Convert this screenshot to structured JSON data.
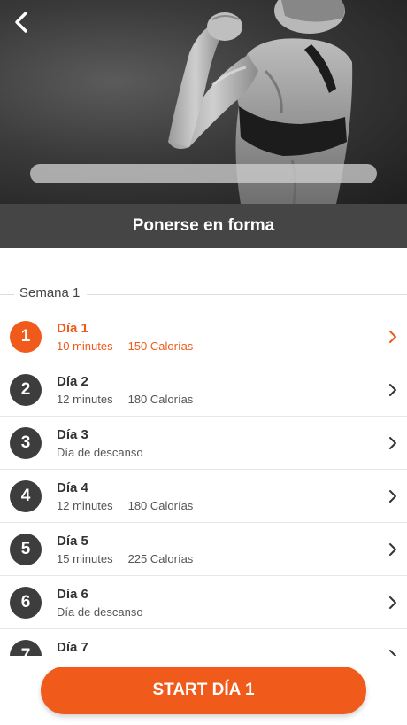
{
  "header": {
    "back_icon": "chevron-left-icon",
    "photo_subject": "athlete-flexing-arm-photo",
    "progress_fraction": 0.0
  },
  "plan": {
    "title": "Ponerse en forma"
  },
  "week": {
    "label": "Semana 1"
  },
  "days": [
    {
      "number": "1",
      "title": "Día 1",
      "minutes": "10 minutes",
      "calories": "150 Calorías",
      "active": true
    },
    {
      "number": "2",
      "title": "Día 2",
      "minutes": "12 minutes",
      "calories": "180 Calorías",
      "active": false
    },
    {
      "number": "3",
      "title": "Día 3",
      "rest": "Día de descanso",
      "active": false
    },
    {
      "number": "4",
      "title": "Día 4",
      "minutes": "12 minutes",
      "calories": "180 Calorías",
      "active": false
    },
    {
      "number": "5",
      "title": "Día 5",
      "minutes": "15 minutes",
      "calories": "225 Calorías",
      "active": false
    },
    {
      "number": "6",
      "title": "Día 6",
      "rest": "Día de descanso",
      "active": false
    },
    {
      "number": "7",
      "title": "Día 7",
      "active": false
    }
  ],
  "start_button": {
    "label": "START DÍA 1"
  },
  "colors": {
    "accent": "#f05a1a",
    "circle": "#3d3d3d",
    "title_bar": "#454545"
  }
}
